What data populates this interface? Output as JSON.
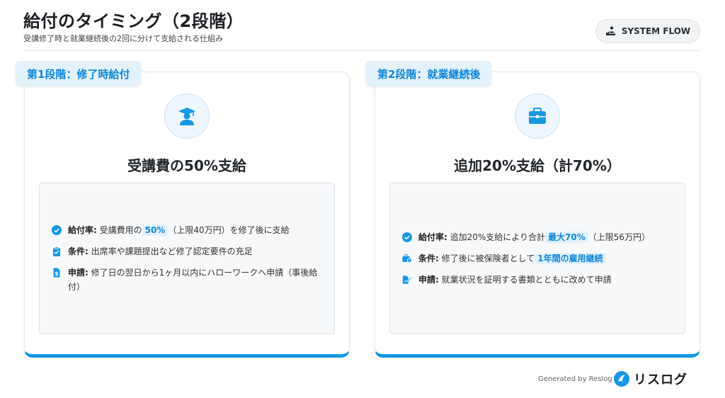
{
  "header": {
    "title": "給付のタイミング（2段階）",
    "subtitle": "受講修了時と就業継続後の2回に分けて支給される仕組み",
    "flow_button": "SYSTEM FLOW"
  },
  "stages": [
    {
      "label": "第1段階：修了時給付",
      "icon": "graduate-icon",
      "heading": "受講費の50%支給",
      "rows": [
        {
          "icon": "check-circle-icon",
          "key": "給付率:",
          "pre": " 受講費用の",
          "highlight": "50%",
          "post": "（上限40万円）を修了後に支給"
        },
        {
          "icon": "clipboard-check-icon",
          "key": "条件:",
          "pre": " 出席率や課題提出など修了認定要件の充足",
          "highlight": "",
          "post": ""
        },
        {
          "icon": "document-dollar-icon",
          "key": "申請:",
          "pre": " 修了日の翌日から1ヶ月以内にハローワークへ申請（事後給付）",
          "highlight": "",
          "post": ""
        }
      ]
    },
    {
      "label": "第2段階：就業継続後",
      "icon": "briefcase-icon",
      "heading": "追加20%支給（計70%）",
      "rows": [
        {
          "icon": "check-circle-icon",
          "key": "給付率:",
          "pre": " 追加20%支給により合計",
          "highlight": "最大70%",
          "post": "（上限56万円）"
        },
        {
          "icon": "briefcase-clock-icon",
          "key": "条件:",
          "pre": " 修了後に被保険者として",
          "highlight": "1年間の雇用継続",
          "post": ""
        },
        {
          "icon": "document-sign-icon",
          "key": "申請:",
          "pre": " 就業状況を証明する書類とともに改めて申請",
          "highlight": "",
          "post": ""
        }
      ]
    }
  ],
  "footer": {
    "generated_by": "Generated by Reslog",
    "logo_text": "リスログ"
  },
  "colors": {
    "accent": "#1597e5",
    "label_bg": "#e3f1fb",
    "highlight_bg": "#e1f0fc"
  }
}
